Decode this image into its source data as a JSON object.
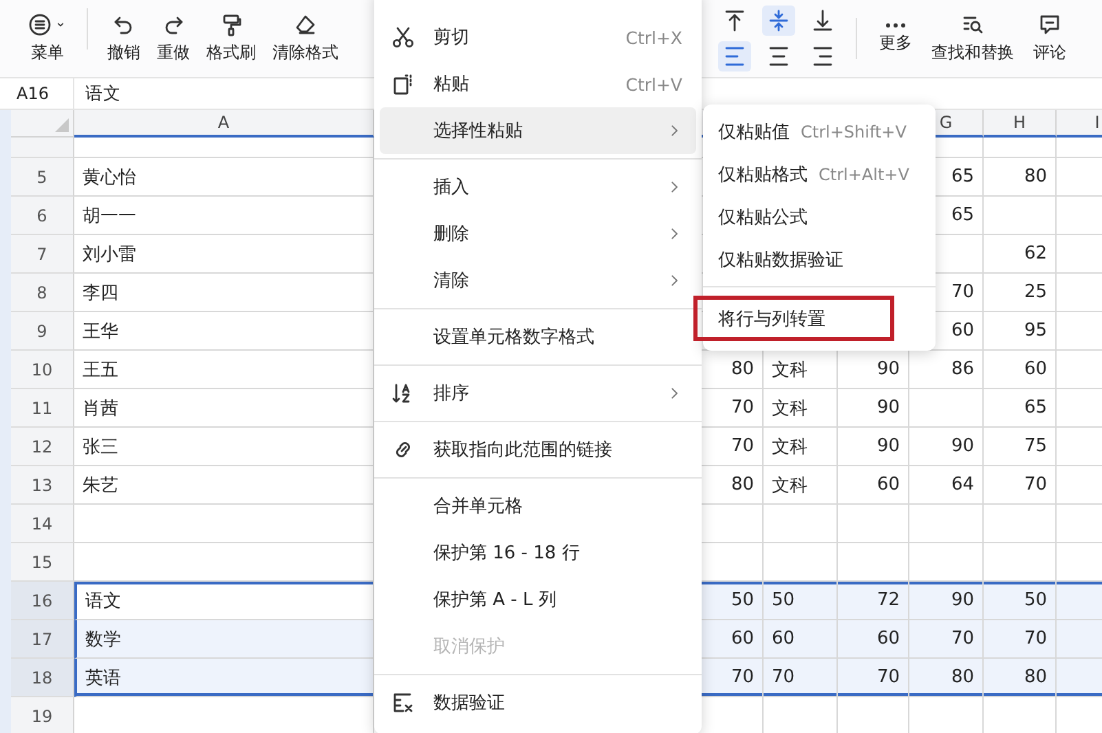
{
  "toolbar": {
    "buttons": [
      {
        "kind": "menu",
        "label": "菜单"
      },
      {
        "kind": "undo",
        "label": "撤销"
      },
      {
        "kind": "redo",
        "label": "重做"
      },
      {
        "kind": "painter",
        "label": "格式刷"
      },
      {
        "kind": "eraser",
        "label": "清除格式"
      }
    ],
    "alignment": [
      {
        "kind": "top",
        "selected": false
      },
      {
        "kind": "middle",
        "selected": true
      },
      {
        "kind": "bottom",
        "selected": false
      },
      {
        "kind": "left",
        "selected": true
      },
      {
        "kind": "center",
        "selected": false
      },
      {
        "kind": "right",
        "selected": false
      }
    ],
    "tools": [
      {
        "kind": "more",
        "label": "更多"
      },
      {
        "kind": "find",
        "label": "查找和替换"
      },
      {
        "kind": "comment",
        "label": "评论"
      }
    ]
  },
  "formula_bar": {
    "cell": "A16",
    "value": "语文"
  },
  "column_headers": {
    "a": "A",
    "g": "G",
    "h": "H",
    "i": "I"
  },
  "rows": [
    {
      "number": "5",
      "selected": false,
      "a": "黄心怡",
      "g": "65",
      "h": "80"
    },
    {
      "number": "6",
      "selected": false,
      "a": "胡一一",
      "g": "65"
    },
    {
      "number": "7",
      "selected": false,
      "a": "刘小雷",
      "h": "62"
    },
    {
      "number": "8",
      "selected": false,
      "a": "李四",
      "g": "70",
      "h": "25"
    },
    {
      "number": "9",
      "selected": false,
      "a": "王华",
      "g": "60",
      "h": "95"
    },
    {
      "number": "10",
      "selected": false,
      "a": "王五",
      "d": "80",
      "e": "文科",
      "f": "90",
      "g": "86",
      "h": "60"
    },
    {
      "number": "11",
      "selected": false,
      "a": "肖茜",
      "d": "70",
      "e": "文科",
      "f": "90",
      "h": "65"
    },
    {
      "number": "12",
      "selected": false,
      "a": "张三",
      "d": "70",
      "e": "文科",
      "f": "90",
      "g": "90",
      "h": "75"
    },
    {
      "number": "13",
      "selected": false,
      "a": "朱艺",
      "d": "80",
      "e": "文科",
      "f": "60",
      "g": "64",
      "h": "70"
    },
    {
      "number": "14",
      "selected": false
    },
    {
      "number": "15",
      "selected": false
    },
    {
      "number": "16",
      "selected": true,
      "a": "语文",
      "d": "50",
      "e": "50",
      "f": "72",
      "g": "90",
      "h": "50"
    },
    {
      "number": "17",
      "selected": true,
      "a": "数学",
      "d": "60",
      "e": "60",
      "f": "60",
      "g": "70",
      "h": "70"
    },
    {
      "number": "18",
      "selected": true,
      "a": "英语",
      "d": "70",
      "e": "70",
      "f": "70",
      "g": "80",
      "h": "80"
    },
    {
      "number": "19",
      "selected": false
    }
  ],
  "context_menu": [
    {
      "kind": "item",
      "label": "剪切",
      "shortcut": "Ctrl+X",
      "submenu": false,
      "hovered": false,
      "disabled": false
    },
    {
      "kind": "item",
      "label": "粘贴",
      "shortcut": "Ctrl+V",
      "submenu": false,
      "hovered": false,
      "disabled": false
    },
    {
      "kind": "item",
      "label": "选择性粘贴",
      "submenu": true,
      "hovered": true,
      "disabled": false
    },
    {
      "kind": "divider"
    },
    {
      "kind": "item",
      "label": "插入",
      "submenu": true,
      "hovered": false,
      "disabled": false
    },
    {
      "kind": "item",
      "label": "删除",
      "submenu": true,
      "hovered": false,
      "disabled": false
    },
    {
      "kind": "item",
      "label": "清除",
      "submenu": true,
      "hovered": false,
      "disabled": false
    },
    {
      "kind": "divider"
    },
    {
      "kind": "item",
      "label": "设置单元格数字格式",
      "submenu": false,
      "hovered": false,
      "disabled": false
    },
    {
      "kind": "divider"
    },
    {
      "kind": "item",
      "label": "排序",
      "submenu": true,
      "hovered": false,
      "disabled": false
    },
    {
      "kind": "divider"
    },
    {
      "kind": "item",
      "label": "获取指向此范围的链接",
      "submenu": false,
      "hovered": false,
      "disabled": false
    },
    {
      "kind": "divider"
    },
    {
      "kind": "item",
      "label": "合并单元格",
      "submenu": false,
      "hovered": false,
      "disabled": false
    },
    {
      "kind": "item",
      "label": "保护第 16 - 18 行",
      "submenu": false,
      "hovered": false,
      "disabled": false
    },
    {
      "kind": "item",
      "label": "保护第 A - L 列",
      "submenu": false,
      "hovered": false,
      "disabled": false
    },
    {
      "kind": "item",
      "label": "取消保护",
      "submenu": false,
      "hovered": false,
      "disabled": true
    },
    {
      "kind": "divider"
    },
    {
      "kind": "item",
      "label": "数据验证",
      "submenu": false,
      "hovered": false,
      "disabled": false
    }
  ],
  "paste_submenu": [
    {
      "kind": "item",
      "label": "仅粘贴值",
      "shortcut": "Ctrl+Shift+V",
      "annotated": false
    },
    {
      "kind": "item",
      "label": "仅粘贴格式",
      "shortcut": "Ctrl+Alt+V",
      "annotated": false
    },
    {
      "kind": "item",
      "label": "仅粘贴公式",
      "annotated": false
    },
    {
      "kind": "item",
      "label": "仅粘贴数据验证",
      "annotated": false
    },
    {
      "kind": "divider"
    },
    {
      "kind": "item",
      "label": "将行与列转置",
      "annotated": true
    }
  ]
}
